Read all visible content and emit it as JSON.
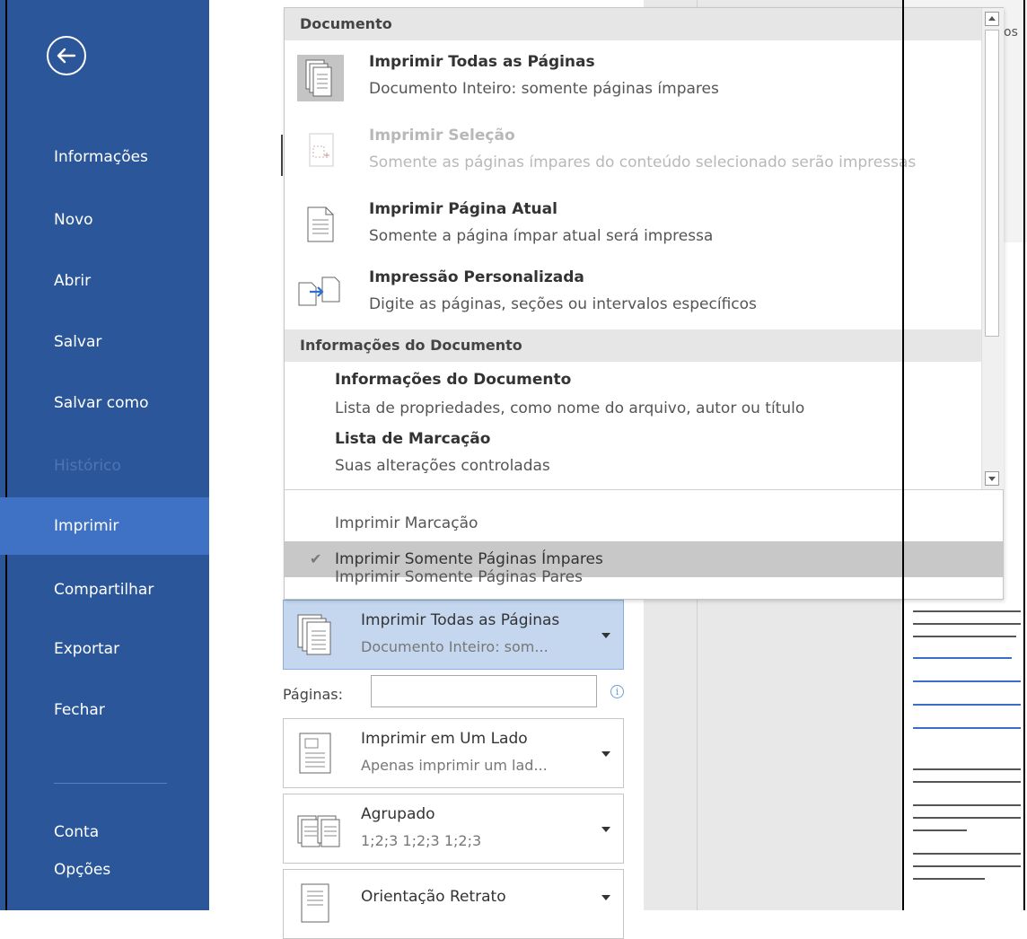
{
  "nav": {
    "items": [
      {
        "label": "Informações"
      },
      {
        "label": "Novo"
      },
      {
        "label": "Abrir"
      },
      {
        "label": "Salvar"
      },
      {
        "label": "Salvar como"
      },
      {
        "label": "Histórico"
      },
      {
        "label": "Imprimir"
      },
      {
        "label": "Compartilhar"
      },
      {
        "label": "Exportar"
      },
      {
        "label": "Fechar"
      },
      {
        "label": "Conta"
      },
      {
        "label": "Opções"
      }
    ],
    "active": "Imprimir",
    "accent": "#2b579a"
  },
  "dropdown": {
    "section_document": "Documento",
    "options": [
      {
        "title": "Imprimir Todas as Páginas",
        "desc": "Documento Inteiro: somente páginas ímpares"
      },
      {
        "title": "Imprimir Seleção",
        "desc": "Somente as páginas ímpares do conteúdo selecionado serão impressas"
      },
      {
        "title": "Imprimir Página Atual",
        "desc": "Somente a página ímpar atual será impressa"
      },
      {
        "title": "Impressão Personalizada",
        "desc": "Digite as páginas, seções ou intervalos específicos"
      }
    ],
    "section_info": "Informações do Documento",
    "info_items": [
      {
        "title": "Informações do Documento",
        "desc": "Lista de propriedades, como nome do arquivo, autor ou título"
      },
      {
        "title": "Lista de Marcação",
        "desc": "Suas alterações controladas"
      }
    ],
    "markup_options": [
      {
        "label": "Imprimir Marcação",
        "checked": false
      },
      {
        "label": "Imprimir Somente Páginas Ímpares",
        "checked": true
      },
      {
        "label": "Imprimir Somente Páginas Pares",
        "checked": false
      }
    ],
    "check_glyph": "✔"
  },
  "settings": {
    "print_range": {
      "title": "Imprimir Todas as Páginas",
      "desc": "Documento Inteiro: som..."
    },
    "pages_label": "Páginas:",
    "pages_value": "",
    "sides": {
      "title": "Imprimir em Um Lado",
      "desc": "Apenas imprimir um lad..."
    },
    "collate": {
      "title": "Agrupado",
      "desc": "1;2;3   1;2;3   1;2;3"
    },
    "orientation": {
      "title": "Orientação Retrato"
    },
    "info_glyph": "i"
  },
  "preview": {
    "top_text": "os"
  }
}
